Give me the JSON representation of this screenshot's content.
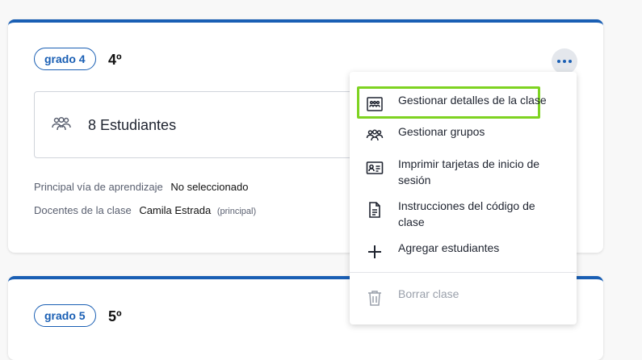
{
  "class_card_1": {
    "grade_badge": "grado 4",
    "grade_level": "4º",
    "students_label": "8 Estudiantes",
    "pathway_key": "Principal vía de aprendizaje",
    "pathway_value": "No seleccionado",
    "teachers_key": "Docentes de la clase",
    "teachers_value": "Camila Estrada",
    "teachers_role": "(principal)"
  },
  "class_card_2": {
    "grade_badge": "grado 5",
    "grade_level": "5º"
  },
  "menu": {
    "items": [
      {
        "label": "Gestionar detalles de la clase",
        "icon": "class-details-icon",
        "highlighted": true
      },
      {
        "label": "Gestionar grupos",
        "icon": "groups-icon"
      },
      {
        "label": "Imprimir tarjetas de inicio de sesión",
        "icon": "id-card-icon"
      },
      {
        "label": "Instrucciones del código de clase",
        "icon": "document-icon"
      },
      {
        "label": "Agregar estudiantes",
        "icon": "plus-icon"
      }
    ],
    "delete_item": {
      "label": "Borrar clase",
      "icon": "trash-icon",
      "disabled": true
    }
  },
  "colors": {
    "accent": "#1a5fb4",
    "highlight": "#7ed321"
  }
}
